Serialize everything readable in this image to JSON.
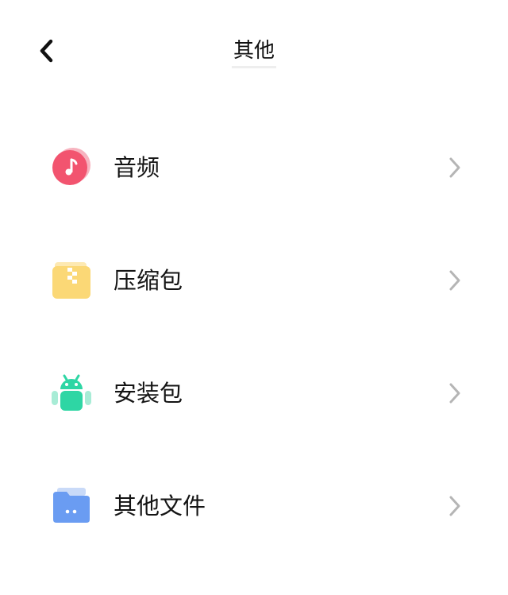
{
  "header": {
    "title": "其他",
    "back_icon": "chevron-left-icon"
  },
  "items": [
    {
      "label": "音频",
      "icon": "music-note-icon",
      "color": "#f2546f"
    },
    {
      "label": "压缩包",
      "icon": "zip-folder-icon",
      "color": "#fbd876"
    },
    {
      "label": "安装包",
      "icon": "android-icon",
      "color": "#2ed6a4"
    },
    {
      "label": "其他文件",
      "icon": "folder-icon",
      "color": "#6a9cf2"
    }
  ],
  "chevron_icon": "chevron-right-icon"
}
